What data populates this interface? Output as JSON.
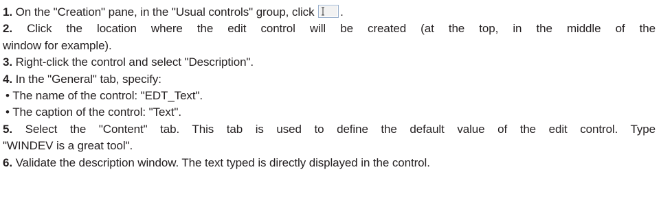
{
  "steps": [
    {
      "num": "1.",
      "before_icon": "On the \"Creation\" pane, in the \"Usual controls\" group, click",
      "after_icon": ".",
      "icon": "edit-control-icon"
    },
    {
      "num": "2.",
      "line1": "Click the location where the edit control will be created (at the top, in the middle of the",
      "line2": "window for example)."
    },
    {
      "num": "3.",
      "text": "Right-click the control and select \"Description\"."
    },
    {
      "num": "4.",
      "text": "In the \"General\" tab, specify:",
      "bullets": [
        "The name of the control: \"EDT_Text\".",
        "The caption of the control: \"Text\"."
      ]
    },
    {
      "num": "5.",
      "line1": "Select the \"Content\" tab. This tab is used to define the default value of the edit control. Type",
      "line2": "\"WINDEV is a great tool\"."
    },
    {
      "num": "6.",
      "text": "Validate the description window. The text typed is directly displayed in the control."
    }
  ],
  "bullet_glyph": "•",
  "colors": {
    "text": "#231f20",
    "icon_fill": "#f2f2f2",
    "icon_border": "#9ab0cc"
  }
}
